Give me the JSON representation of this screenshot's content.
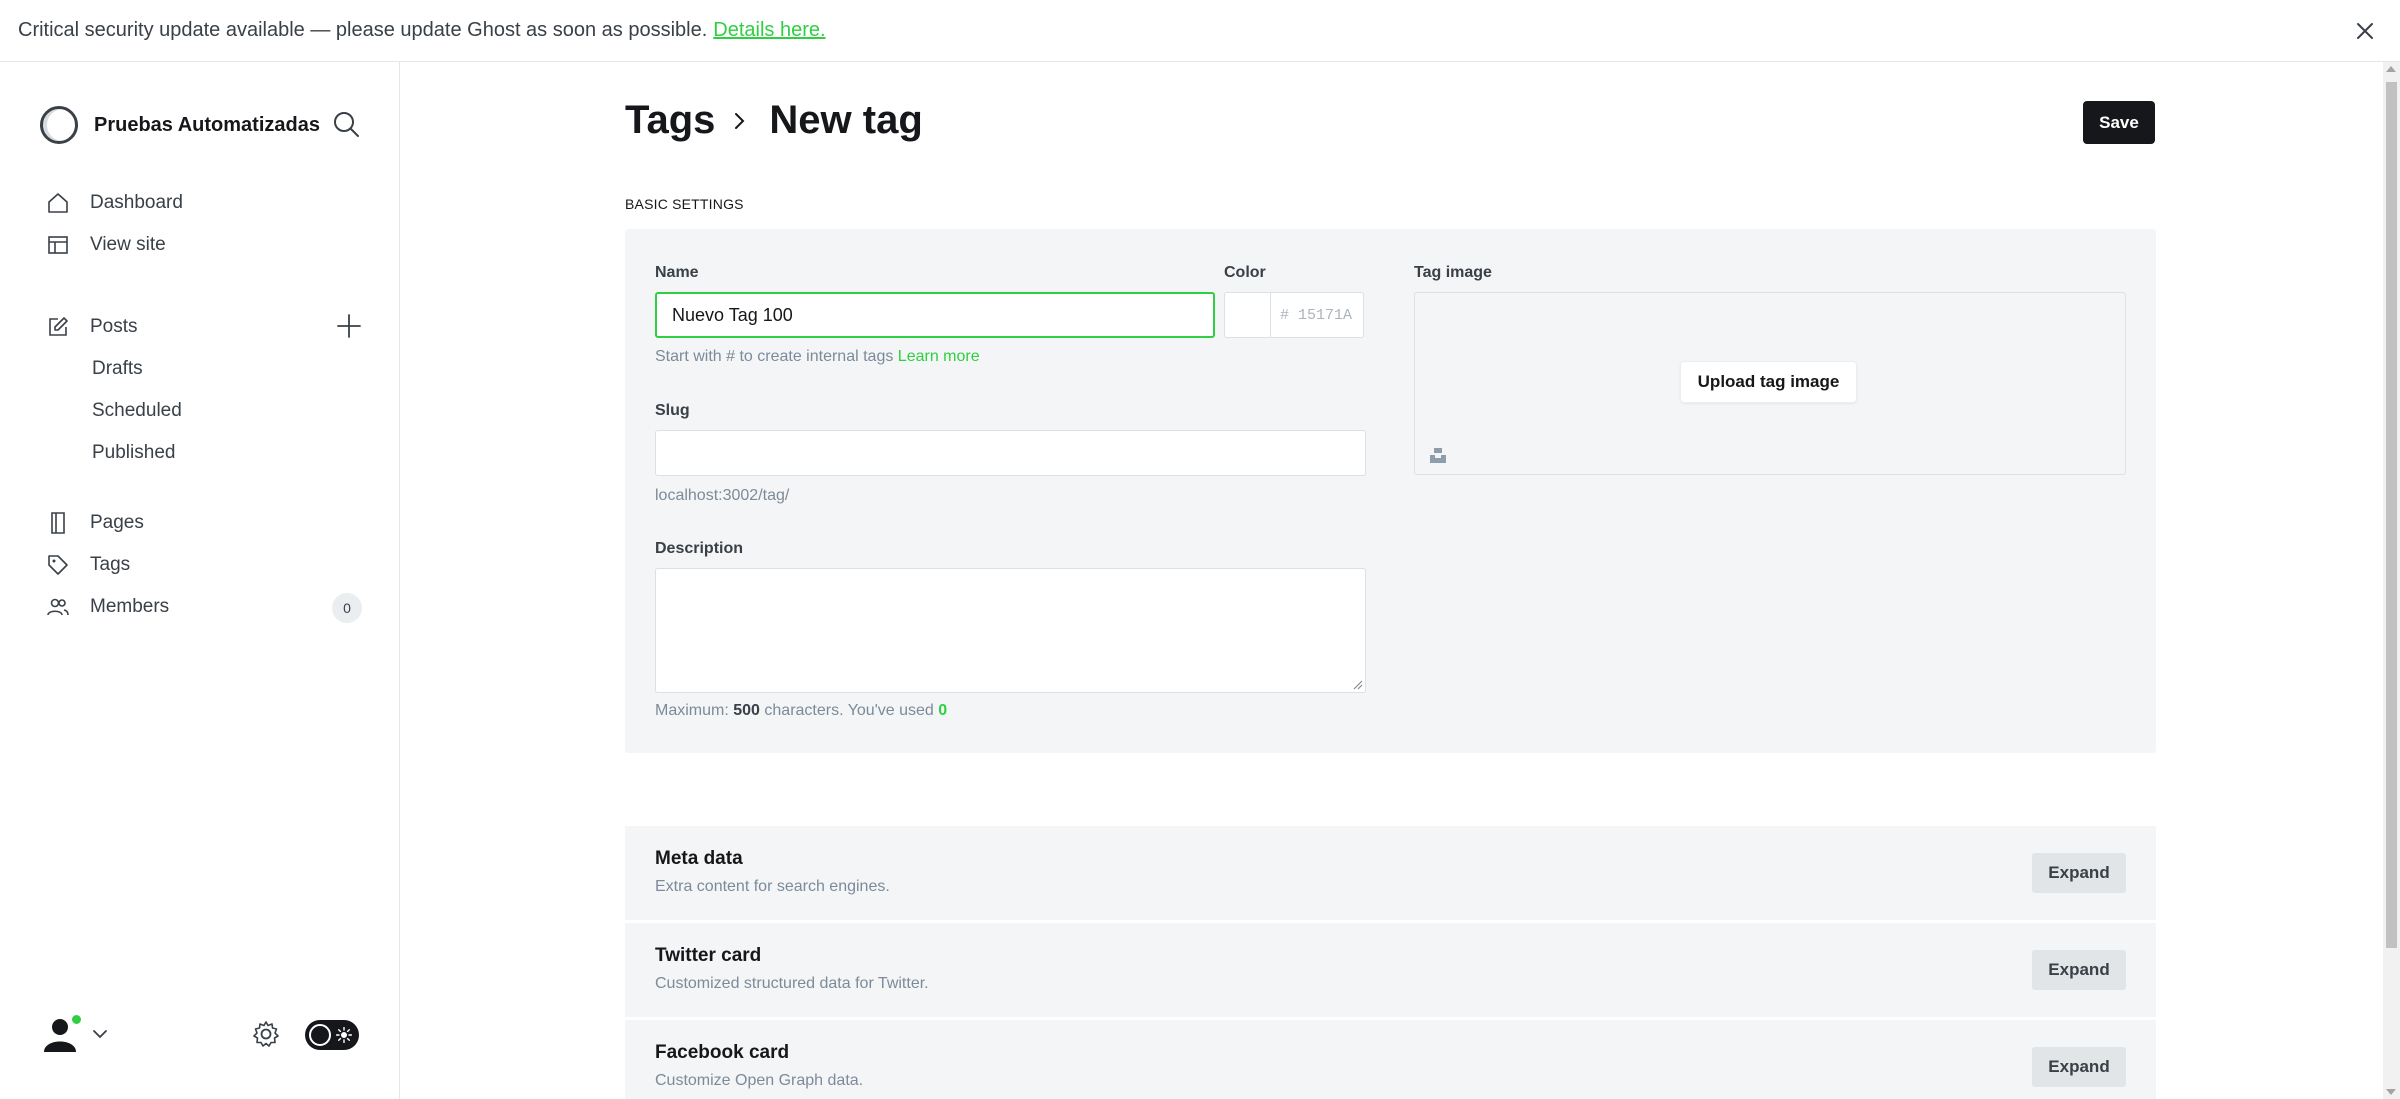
{
  "banner": {
    "message": "Critical security update available — please update Ghost as soon as possible.",
    "link_label": "Details here."
  },
  "sidebar": {
    "site_name": "Pruebas Automatizadas",
    "nav": {
      "dashboard": "Dashboard",
      "view_site": "View site",
      "posts": "Posts",
      "drafts": "Drafts",
      "scheduled": "Scheduled",
      "published": "Published",
      "pages": "Pages",
      "tags": "Tags",
      "members": "Members",
      "members_count": "0"
    }
  },
  "header": {
    "parent": "Tags",
    "current": "New tag",
    "save_label": "Save"
  },
  "basic": {
    "section_label": "BASIC SETTINGS",
    "name_label": "Name",
    "name_value": "Nuevo Tag 100",
    "name_hint": "Start with # to create internal tags",
    "learn_more": "Learn more",
    "color_label": "Color",
    "color_placeholder": "# 15171A",
    "slug_label": "Slug",
    "slug_value": "",
    "slug_hint": "localhost:3002/tag/",
    "description_label": "Description",
    "description_value": "",
    "desc_hint_prefix": "Maximum:",
    "desc_max": "500",
    "desc_hint_mid": "characters. You've used",
    "desc_used": "0",
    "image_label": "Tag image",
    "upload_label": "Upload tag image"
  },
  "cards": [
    {
      "title": "Meta data",
      "desc": "Extra content for search engines.",
      "button": "Expand"
    },
    {
      "title": "Twitter card",
      "desc": "Customized structured data for Twitter.",
      "button": "Expand"
    },
    {
      "title": "Facebook card",
      "desc": "Customize Open Graph data.",
      "button": "Expand"
    }
  ],
  "colors": {
    "accent": "#30cf43",
    "dark": "#15171a",
    "panel": "#f4f5f6"
  },
  "icons": {
    "close": "close-icon",
    "search": "search-icon",
    "home": "home-icon",
    "view_site": "window-icon",
    "posts": "edit-icon",
    "add": "plus-icon",
    "pages": "page-icon",
    "tags": "tag-icon",
    "members": "members-icon",
    "chevron": "chevron-right-icon",
    "settings": "gear-icon",
    "theme": "sun-icon",
    "unsplash": "unsplash-icon"
  }
}
